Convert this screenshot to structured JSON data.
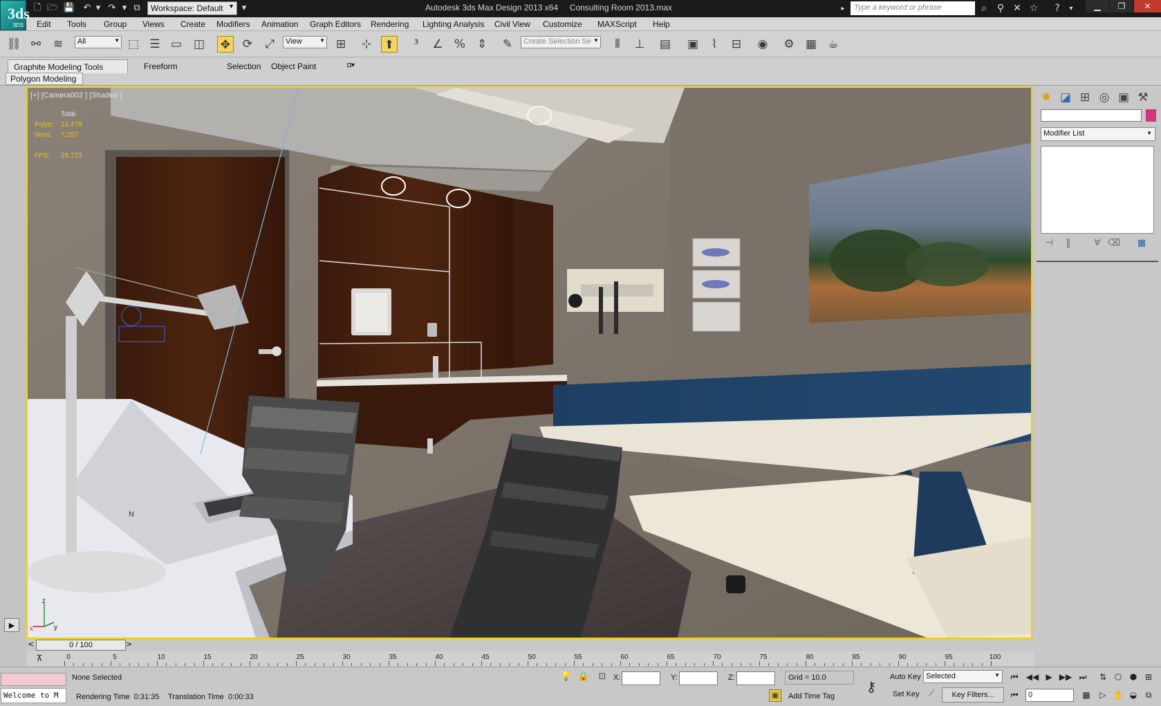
{
  "title_bar": {
    "app_logo_text": "3ds",
    "app_logo_sub": "3DS",
    "workspace": "Workspace: Default",
    "window_title": "Autodesk 3ds Max Design 2013 x64     Consulting Room 2013.max",
    "search_placeholder": "Type a keyword or phrase"
  },
  "menu": [
    "Edit",
    "Tools",
    "Group",
    "Views",
    "Create",
    "Modifiers",
    "Animation",
    "Graph Editors",
    "Rendering",
    "Lighting Analysis",
    "Civil View",
    "Customize",
    "MAXScript",
    "Help"
  ],
  "toolbar": {
    "selection_filter": "All",
    "reference_coord": "View",
    "named_selection_placeholder": "Create Selection Se"
  },
  "ribbon": {
    "tabs": [
      "Graphite Modeling Tools",
      "Freeform",
      "Selection",
      "Object Paint"
    ],
    "panel_label": "Polygon Modeling"
  },
  "viewport": {
    "label": "[+] [Camera002 ] [Shaded ]",
    "stats": {
      "header": "Total",
      "polys_label": "Polys:",
      "polys_value": "14,479",
      "verts_label": "Verts:",
      "verts_value": "7,257",
      "fps_label": "FPS:",
      "fps_value": "28.723"
    },
    "compass_label": "N",
    "axis_z": "z",
    "axis_x": "x",
    "axis_y": "y"
  },
  "command_panel": {
    "modifier_list": "Modifier List"
  },
  "time_slider": {
    "position": "0 / 100",
    "prev": "<",
    "next": ">",
    "current_frame": 0,
    "total_frames": 100,
    "tick_labels": [
      "0",
      "5",
      "10",
      "15",
      "20",
      "25",
      "30",
      "35",
      "40",
      "45",
      "50",
      "55",
      "60",
      "65",
      "70",
      "75",
      "80",
      "85",
      "90",
      "95",
      "100"
    ]
  },
  "status_bar": {
    "maxscript_listener": "Welcome to M",
    "selection": "None Selected",
    "rendering_time": "Rendering Time  0:31:35",
    "translation_time": "Translation Time  0:00:33",
    "x_label": "X:",
    "y_label": "Y:",
    "z_label": "Z:",
    "grid": "Grid = 10.0",
    "add_time_tag": "Add Time Tag",
    "auto_key": "Auto Key",
    "set_key": "Set Key",
    "key_mode": "Selected",
    "key_filters": "Key Filters...",
    "frame": "0"
  },
  "colors": {
    "active_viewport_border": "#f0d400",
    "stats_text": "#f2c400",
    "object_color": "#d6357e"
  }
}
